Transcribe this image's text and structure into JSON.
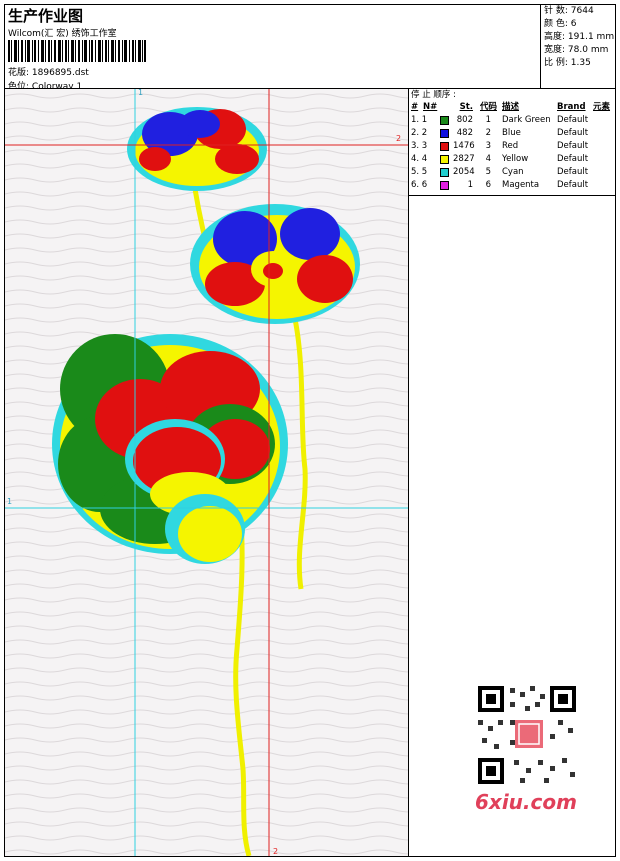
{
  "header": {
    "title": "生产作业图",
    "company": "Wilcom(汇 宏) 绣饰工作室",
    "design_label": "花版:",
    "design_value": "1896895.dst",
    "colorway_label": "色位:",
    "colorway_value": "Colorway 1"
  },
  "stats": [
    {
      "label": "针 数:",
      "value": "7644"
    },
    {
      "label": "颜 色:",
      "value": "6"
    },
    {
      "label": "高度:",
      "value": "191.1 mm"
    },
    {
      "label": "宽度:",
      "value": "78.0 mm"
    },
    {
      "label": "比 例:",
      "value": "1.35"
    }
  ],
  "sequence": {
    "title": "停 止 顺序 :",
    "headers": {
      "num": "#",
      "n": "N#",
      "st": "St.",
      "code": "代码",
      "desc": "描述",
      "brand": "Brand",
      "element": "元素"
    },
    "rows": [
      {
        "idx": "1. 1",
        "color": "#1a8a1a",
        "st": "802",
        "code": "1",
        "desc": "Dark Green",
        "brand": "Default"
      },
      {
        "idx": "2. 2",
        "color": "#1010e0",
        "st": "482",
        "code": "2",
        "desc": "Blue",
        "brand": "Default"
      },
      {
        "idx": "3. 3",
        "color": "#e01010",
        "st": "1476",
        "code": "3",
        "desc": "Red",
        "brand": "Default"
      },
      {
        "idx": "4. 4",
        "color": "#f5f500",
        "st": "2827",
        "code": "4",
        "desc": "Yellow",
        "brand": "Default"
      },
      {
        "idx": "5. 5",
        "color": "#20d0d0",
        "st": "2054",
        "code": "5",
        "desc": "Cyan",
        "brand": "Default"
      },
      {
        "idx": "6. 6",
        "color": "#e020e0",
        "st": "1",
        "code": "6",
        "desc": "Magenta",
        "brand": "Default"
      }
    ]
  },
  "markers": {
    "one": "1",
    "two": "2"
  },
  "watermark": "6xiu.com",
  "colors": {
    "guide_cyan": "#30d0e0",
    "guide_red": "#e02020"
  }
}
